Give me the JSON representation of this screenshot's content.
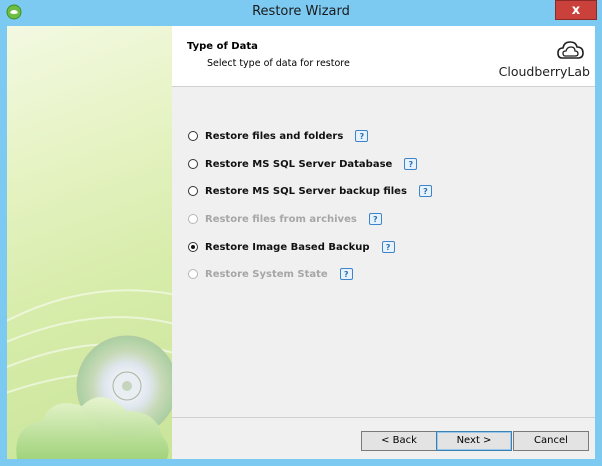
{
  "window": {
    "title": "Restore Wizard",
    "close_glyph": "x"
  },
  "header": {
    "title": "Type of Data",
    "subtitle": "Select type of data for restore",
    "logo_text": "CloudberryLab"
  },
  "options": [
    {
      "label": "Restore files and folders",
      "enabled": true,
      "checked": false
    },
    {
      "label": "Restore MS SQL Server Database",
      "enabled": true,
      "checked": false
    },
    {
      "label": "Restore MS SQL Server backup files",
      "enabled": true,
      "checked": false
    },
    {
      "label": "Restore files from archives",
      "enabled": false,
      "checked": false
    },
    {
      "label": "Restore Image Based Backup",
      "enabled": true,
      "checked": true
    },
    {
      "label": "Restore System State",
      "enabled": false,
      "checked": false
    }
  ],
  "help_glyph": "?",
  "buttons": {
    "back": "< Back",
    "next": "Next >",
    "cancel": "Cancel"
  },
  "colors": {
    "title_bar": "#7ccaf2",
    "close": "#c9413a",
    "accent": "#3c7fb1"
  }
}
